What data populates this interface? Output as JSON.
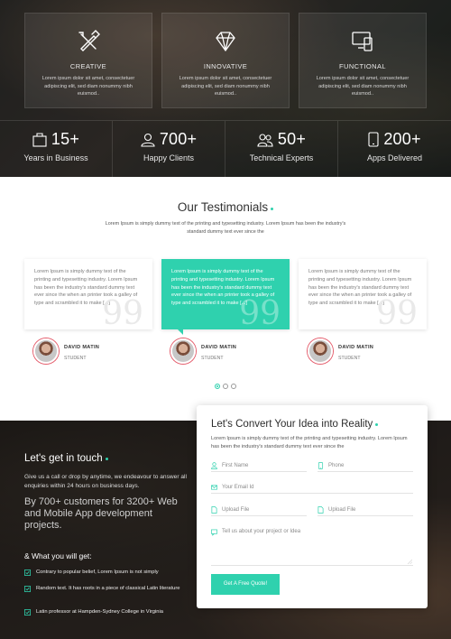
{
  "features": [
    {
      "icon": "design-tools-icon",
      "title": "CREATIVE",
      "text": "Lorem ipsum dolor sit amet, consectetuer adipiscing elit, sed diam nonummy nibh euismod.."
    },
    {
      "icon": "diamond-icon",
      "title": "INNOVATIVE",
      "text": "Lorem ipsum dolor sit amet, consectetuer adipiscing elit, sed diam nonummy nibh euismod.."
    },
    {
      "icon": "devices-icon",
      "title": "FUNCTIONAL",
      "text": "Lorem ipsum dolor sit amet, consectetuer adipiscing elit, sed diam nonummy nibh euismod.."
    }
  ],
  "stats": [
    {
      "icon": "briefcase-icon",
      "number": "15+",
      "label": "Years in Business"
    },
    {
      "icon": "user-icon",
      "number": "700+",
      "label": "Happy Clients"
    },
    {
      "icon": "users-icon",
      "number": "50+",
      "label": "Technical Experts"
    },
    {
      "icon": "mobile-icon",
      "number": "200+",
      "label": "Apps Delivered"
    }
  ],
  "testimonials": {
    "title": "Our Testimonials",
    "subtitle": "Lorem Ipsum is simply dummy text of the printing and typesetting industry. Lorem Ipsum has been the industry's standard dummy text ever since the",
    "items": [
      {
        "text": "Lorem Ipsum is simply dummy text of the printing and typesetting industry. Lorem Ipsum has been the industry's standard dummy text ever since the when an printer took a galley of type and scrambled it to make [...]",
        "name": "DAVID MATIN",
        "role": "STUDENT"
      },
      {
        "text": "Lorem Ipsum is simply dummy text of the printing and typesetting industry. Lorem Ipsum has been the industry's standard dummy text ever since the when an printer took a galley of type and scrambled it to make [...]",
        "name": "DAVID MATIN",
        "role": "STUDENT"
      },
      {
        "text": "Lorem Ipsum is simply dummy text of the printing and typesetting industry. Lorem Ipsum has been the industry's standard dummy text ever since the when an printer took a galley of type and scrambled it to make [...]",
        "name": "DAVID MATIN",
        "role": "STUDENT"
      }
    ],
    "quote_mark": "99",
    "active_page": 1,
    "page_count": 3
  },
  "contact": {
    "title": "Let's get in touch",
    "description": "Give us a call or drop by anytime, we endeavour to answer all enquiries within 24 hours on business days.",
    "highlight": "By 700+ customers for 3200+ Web and Mobile App development projects.",
    "what_title": "& What you will get:",
    "bullets": [
      "Contrary to popular belief, Lorem Ipsum is not simply",
      "Random text. It has roots in a piece of classical Latin literature",
      "Latin professor at Hampden-Sydney College in Virginia"
    ]
  },
  "form": {
    "title": "Let's Convert Your Idea into Reality",
    "description": "Lorem Ipsum is simply dummy text of the printing and typesetting industry. Lorem Ipsum has been the industry's standard dummy text ever since the",
    "first_name_placeholder": "First Name",
    "phone_placeholder": "Phone",
    "email_placeholder": "Your Email Id",
    "upload1_placeholder": "Upload File",
    "upload2_placeholder": "Upload File",
    "message_placeholder": "Tell us about your project or Idea",
    "submit_label": "Get A Free Quote!"
  },
  "colors": {
    "accent": "#2fd1ae",
    "avatar_ring": "#e45b6a"
  }
}
